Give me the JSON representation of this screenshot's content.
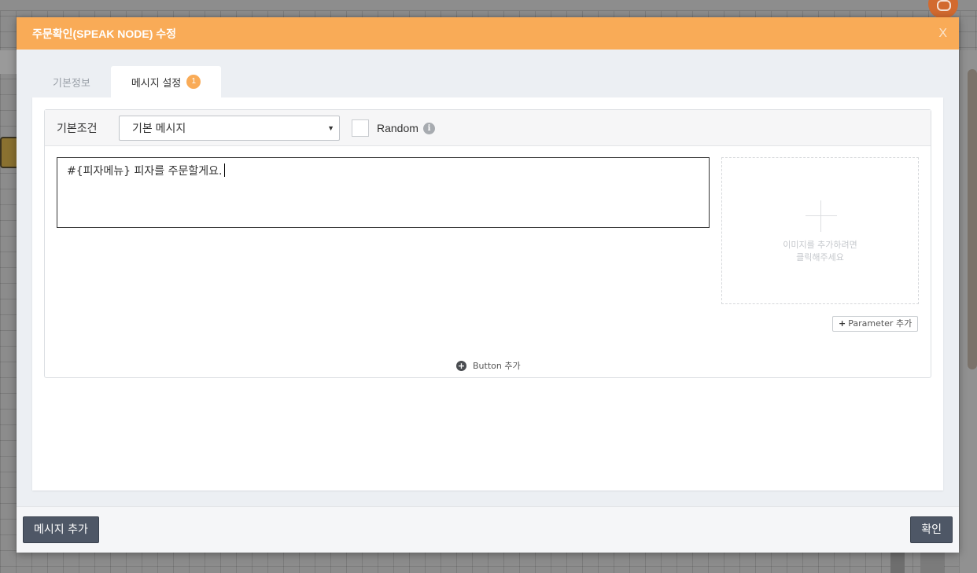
{
  "modal": {
    "title": "주문확인(SPEAK NODE) 수정",
    "close_label": "X"
  },
  "tabs": [
    {
      "label": "기본정보",
      "active": false
    },
    {
      "label": "메시지 설정",
      "active": true,
      "badge": "1"
    }
  ],
  "message": {
    "condition_label": "기본조건",
    "condition_value": "기본 메시지",
    "random_label": "Random",
    "random_checked": false,
    "text_value": "#{피자메뉴} 피자를 주문할게요.",
    "image_placeholder_line1": "이미지를 추가하려면",
    "image_placeholder_line2": "클릭해주세요",
    "parameter_add_label": "Parameter 추가",
    "button_add_label": "Button 추가"
  },
  "footer": {
    "add_message_label": "메시지 추가",
    "confirm_label": "확인"
  },
  "colors": {
    "header": "#f9ab57",
    "badge": "#f9ab57",
    "footer_button": "#4e5766"
  },
  "icons": {
    "info": "info-icon",
    "plus": "plus-icon",
    "circle_plus": "circle-plus-icon"
  }
}
